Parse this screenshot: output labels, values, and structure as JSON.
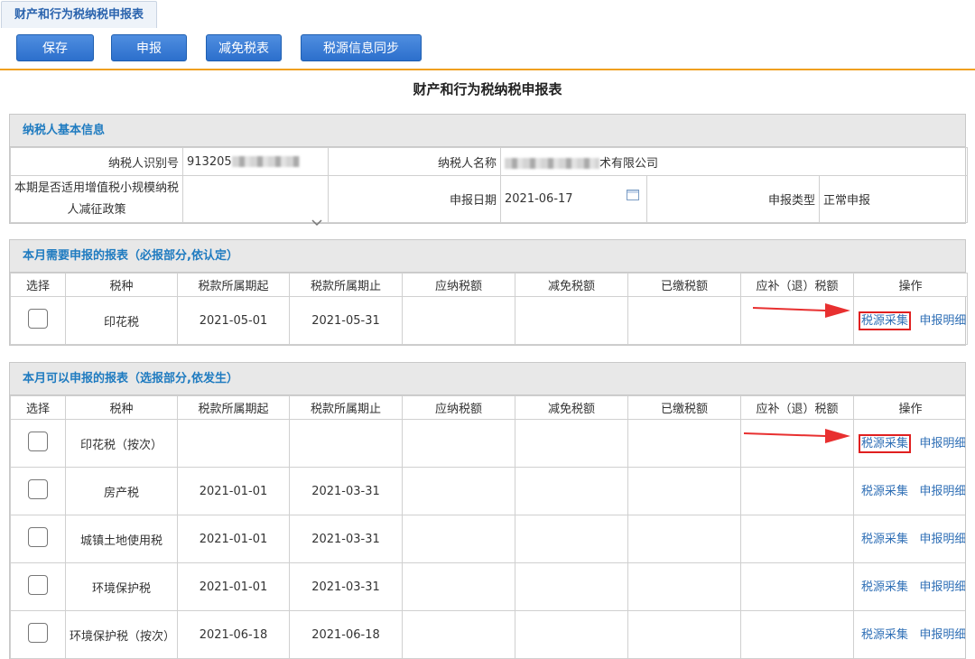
{
  "tab": {
    "label": "财产和行为税纳税申报表"
  },
  "toolbar": {
    "save": "保存",
    "declare": "申报",
    "reduce_table": "减免税表",
    "sync": "税源信息同步"
  },
  "page_title": "财产和行为税纳税申报表",
  "basic_info": {
    "title": "纳税人基本信息",
    "taxpayer_id_label": "纳税人识别号",
    "taxpayer_id_value": "913205",
    "taxpayer_name_label": "纳税人名称",
    "taxpayer_name_value": "术有限公司",
    "small_scale_label": "本期是否适用增值税小规模纳税人减征政策",
    "small_scale_value": "",
    "declare_date_label": "申报日期",
    "declare_date_value": "2021-06-17",
    "declare_type_label": "申报类型",
    "declare_type_value": "正常申报"
  },
  "columns": [
    "选择",
    "税种",
    "税款所属期起",
    "税款所属期止",
    "应纳税额",
    "减免税额",
    "已缴税额",
    "应补（退）税额",
    "操作"
  ],
  "ops": {
    "collect": "税源采集",
    "detail": "申报明细"
  },
  "required": {
    "title": "本月需要申报的报表（必报部分,依认定）",
    "rows": [
      {
        "tax": "印花税",
        "start": "2021-05-01",
        "end": "2021-05-31"
      }
    ]
  },
  "optional": {
    "title": "本月可以申报的报表（选报部分,依发生）",
    "rows": [
      {
        "tax": "印花税（按次）",
        "start": "",
        "end": ""
      },
      {
        "tax": "房产税",
        "start": "2021-01-01",
        "end": "2021-03-31"
      },
      {
        "tax": "城镇土地使用税",
        "start": "2021-01-01",
        "end": "2021-03-31"
      },
      {
        "tax": "环境保护税",
        "start": "2021-01-01",
        "end": "2021-03-31"
      },
      {
        "tax": "环境保护税（按次）",
        "start": "2021-06-18",
        "end": "2021-06-18"
      }
    ]
  },
  "colors": {
    "accent": "#2c6fcc",
    "highlight": "#e02020",
    "divider": "#f0a020"
  }
}
